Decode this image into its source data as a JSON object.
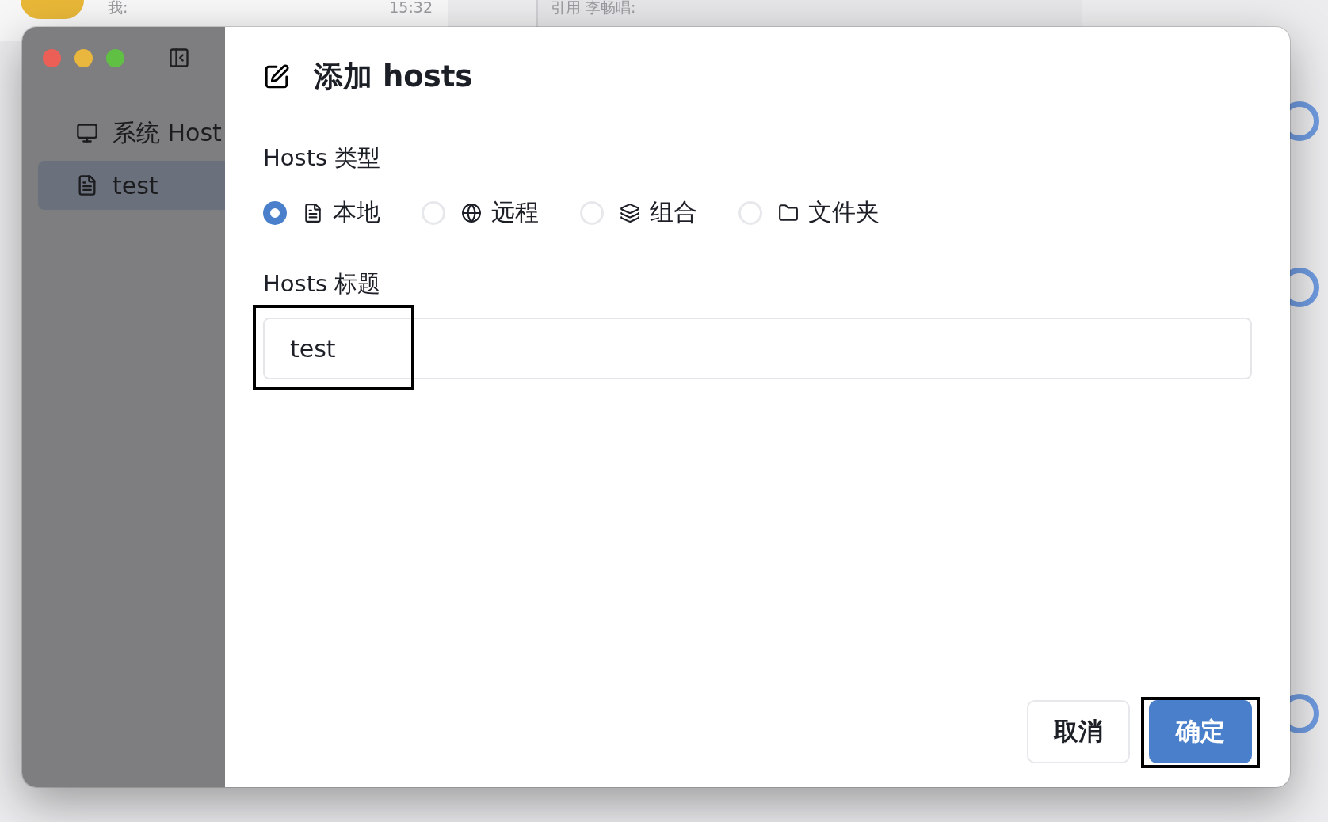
{
  "background_app": {
    "chat_preview": {
      "sender": "我:",
      "time": "15:32"
    },
    "quote": {
      "text": "引用 李畅唱:"
    }
  },
  "sidebar": {
    "items": [
      {
        "label": "系统 Host",
        "kind": "monitor",
        "selected": false
      },
      {
        "label": "test",
        "kind": "file",
        "selected": true
      }
    ]
  },
  "dialog": {
    "title": "添加 hosts",
    "type_field": {
      "label": "Hosts 类型",
      "options": [
        {
          "label": "本地",
          "kind": "file",
          "selected": true
        },
        {
          "label": "远程",
          "kind": "globe",
          "selected": false
        },
        {
          "label": "组合",
          "kind": "layers",
          "selected": false
        },
        {
          "label": "文件夹",
          "kind": "folder",
          "selected": false
        }
      ]
    },
    "title_field": {
      "label": "Hosts 标题",
      "value": "test",
      "highlighted": true
    },
    "buttons": [
      {
        "label": "取消",
        "kind": "secondary",
        "highlighted": false
      },
      {
        "label": "确定",
        "kind": "primary",
        "highlighted": true
      }
    ]
  }
}
